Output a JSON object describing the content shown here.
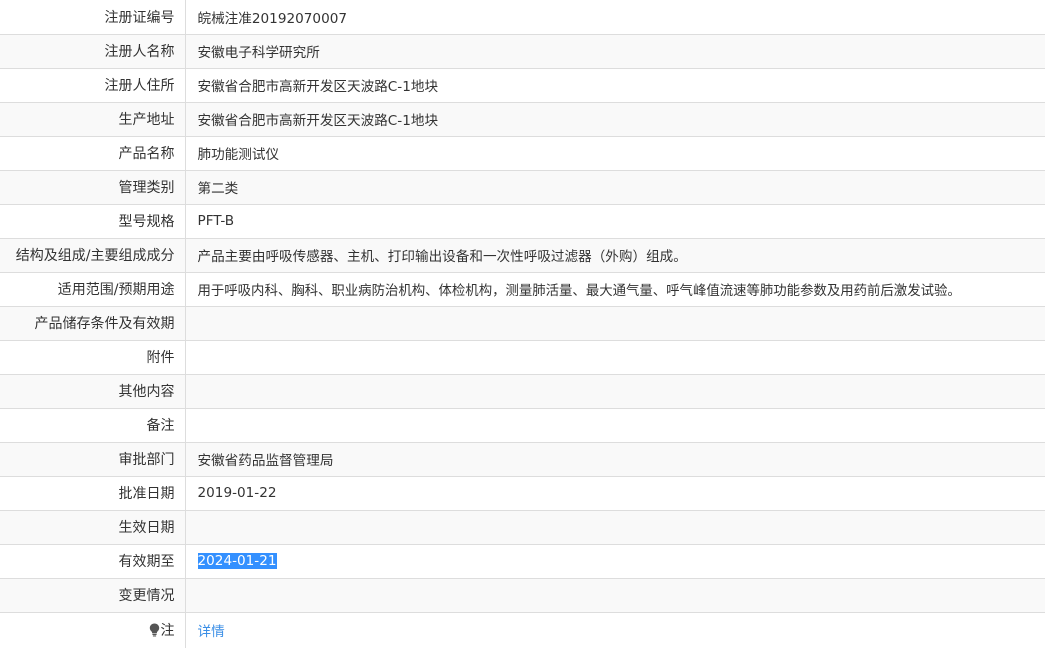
{
  "rows": [
    {
      "label": "注册证编号",
      "value": "皖械注准20192070007"
    },
    {
      "label": "注册人名称",
      "value": "安徽电子科学研究所"
    },
    {
      "label": "注册人住所",
      "value": "安徽省合肥市高新开发区天波路C-1地块"
    },
    {
      "label": "生产地址",
      "value": "安徽省合肥市高新开发区天波路C-1地块"
    },
    {
      "label": "产品名称",
      "value": "肺功能测试仪"
    },
    {
      "label": "管理类别",
      "value": "第二类"
    },
    {
      "label": "型号规格",
      "value": "PFT-B"
    },
    {
      "label": "结构及组成/主要组成成分",
      "value": "产品主要由呼吸传感器、主机、打印输出设备和一次性呼吸过滤器（外购）组成。"
    },
    {
      "label": "适用范围/预期用途",
      "value": "用于呼吸内科、胸科、职业病防治机构、体检机构，测量肺活量、最大通气量、呼气峰值流速等肺功能参数及用药前后激发试验。"
    },
    {
      "label": "产品储存条件及有效期",
      "value": ""
    },
    {
      "label": "附件",
      "value": ""
    },
    {
      "label": "其他内容",
      "value": ""
    },
    {
      "label": "备注",
      "value": ""
    },
    {
      "label": "审批部门",
      "value": "安徽省药品监督管理局"
    },
    {
      "label": "批准日期",
      "value": "2019-01-22"
    },
    {
      "label": "生效日期",
      "value": ""
    },
    {
      "label": "有效期至",
      "value": "2024-01-21"
    },
    {
      "label": "变更情况",
      "value": ""
    },
    {
      "label": "注",
      "value": "详情"
    }
  ],
  "note_icon": "lightbulb-icon",
  "colors": {
    "selection": "#3390ff",
    "link": "#3a8ee6",
    "border": "#dddddd",
    "stripe": "#f9f9f9"
  }
}
